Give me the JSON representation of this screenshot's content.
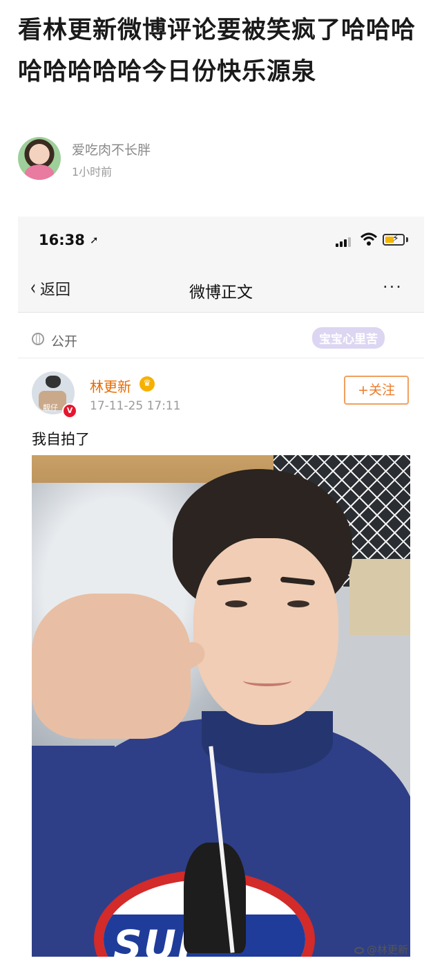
{
  "article": {
    "title": "看林更新微博评论要被笑疯了哈哈哈哈哈哈哈哈今日份快乐源泉",
    "author": "爱吃肉不长胖",
    "posted": "1小时前"
  },
  "embedded_screenshot": {
    "status_bar": {
      "time": "16:38"
    },
    "nav": {
      "back_label": "返回",
      "title": "微博正文",
      "more": "···"
    },
    "privacy": {
      "label": "公开",
      "watermark": "宝宝心里苦"
    },
    "post": {
      "author": "林更新",
      "time": "17-11-25 17:11",
      "follow_label": "+关注",
      "text": "我自拍了",
      "avatar_tag": "靓仔",
      "verified_mark": "V",
      "shirt_text": "SUP"
    }
  },
  "image_watermark": "@林更新",
  "colors": {
    "accent_orange": "#e86b00",
    "follow_border": "#f0a060",
    "verified_red": "#e6162d"
  }
}
